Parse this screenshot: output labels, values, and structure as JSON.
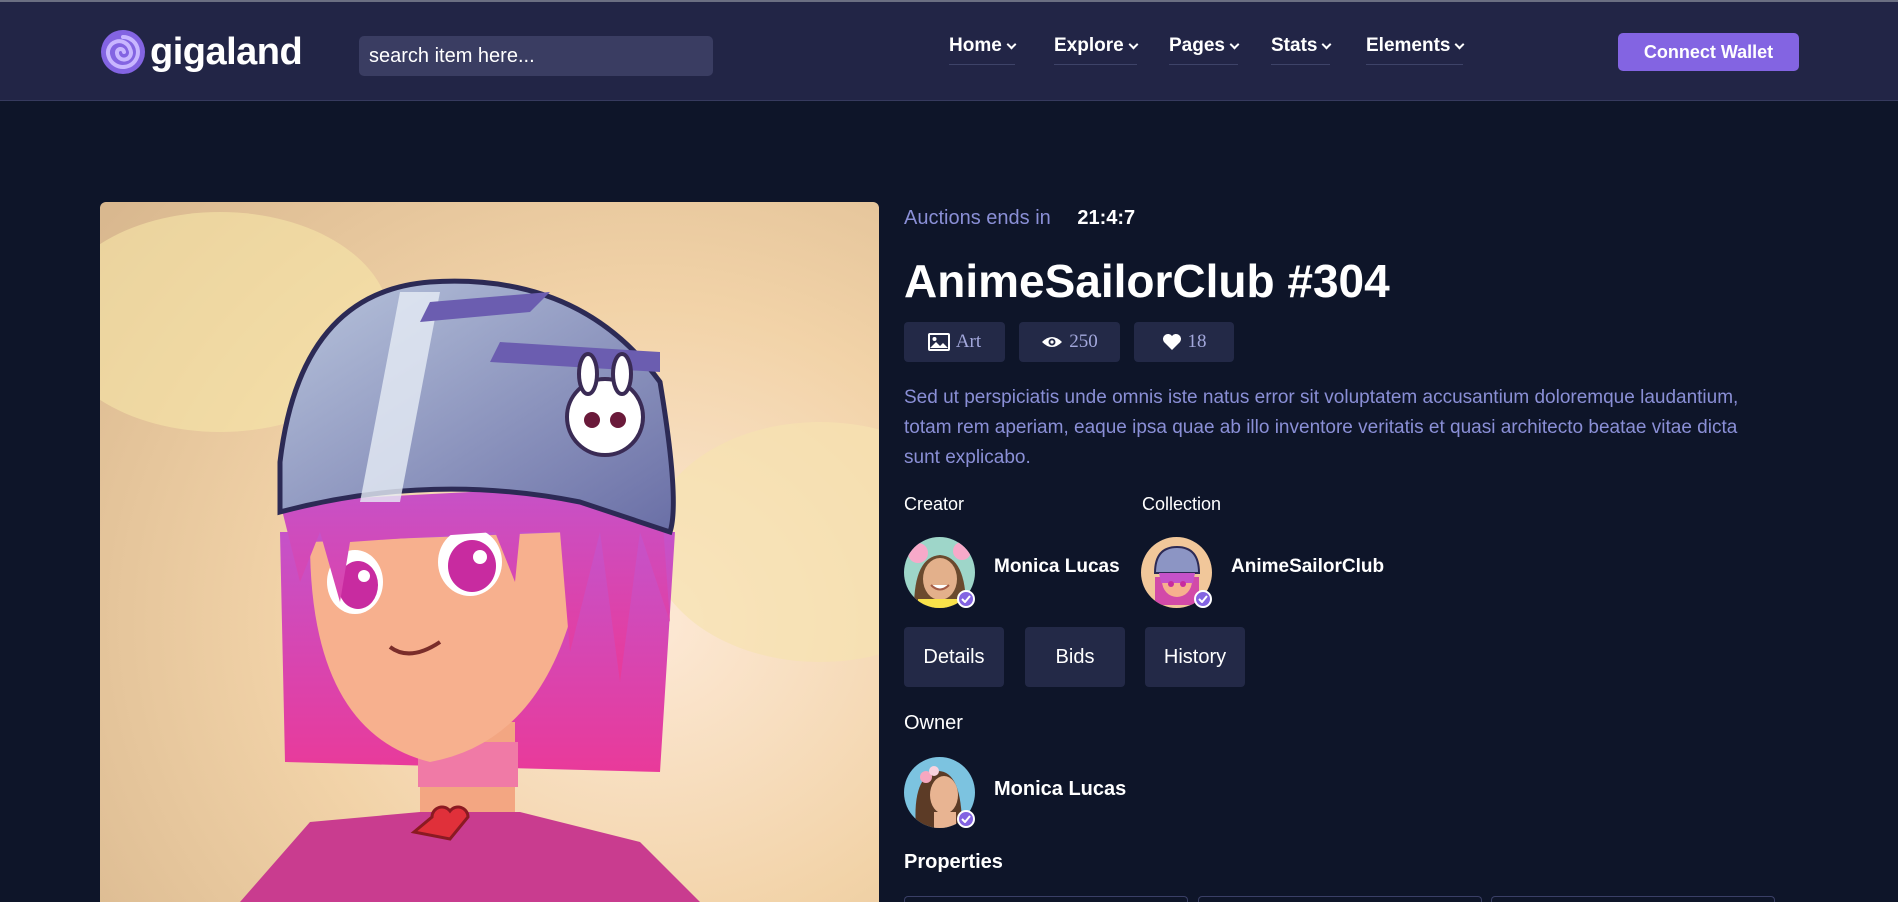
{
  "brand": {
    "name": "gigaland",
    "accent": "#8364e2"
  },
  "header": {
    "search_placeholder": "search item here...",
    "nav": [
      {
        "label": "Home"
      },
      {
        "label": "Explore"
      },
      {
        "label": "Pages"
      },
      {
        "label": "Stats"
      },
      {
        "label": "Elements"
      }
    ],
    "connect_label": "Connect Wallet"
  },
  "item": {
    "auction_label": "Auctions ends in",
    "auction_time": "21:4:7",
    "title": "AnimeSailorClub #304",
    "tags": {
      "category": {
        "icon": "image-icon",
        "label": "Art"
      },
      "views": {
        "icon": "eye-icon",
        "label": "250"
      },
      "likes": {
        "icon": "heart-icon",
        "label": "18"
      }
    },
    "description": "Sed ut perspiciatis unde omnis iste natus error sit voluptatem accusantium doloremque laudantium, totam rem aperiam, eaque ipsa quae ab illo inventore veritatis et quasi architecto beatae vitae dicta sunt explicabo.",
    "creator": {
      "heading": "Creator",
      "name": "Monica Lucas"
    },
    "collection": {
      "heading": "Collection",
      "name": "AnimeSailorClub"
    },
    "tabs": [
      "Details",
      "Bids",
      "History"
    ],
    "owner": {
      "heading": "Owner",
      "name": "Monica Lucas"
    },
    "properties_heading": "Properties"
  }
}
